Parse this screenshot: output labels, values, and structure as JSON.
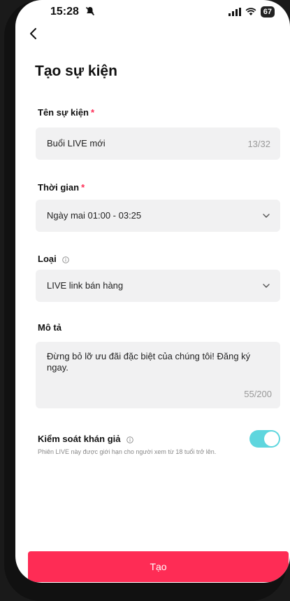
{
  "status_bar": {
    "time": "15:28",
    "battery": "67"
  },
  "header": {
    "title": "Tạo sự kiện"
  },
  "event_name": {
    "label": "Tên sự kiện",
    "required_mark": "*",
    "value": "Buổi LIVE mới",
    "counter": "13/32"
  },
  "time": {
    "label": "Thời gian",
    "required_mark": "*",
    "value": "Ngày mai 01:00 - 03:25"
  },
  "type": {
    "label": "Loại",
    "value": "LIVE link bán hàng"
  },
  "description": {
    "label": "Mô tả",
    "value": "Đừng bỏ lỡ ưu đãi đặc biệt của chúng tôi! Đăng ký ngay.",
    "counter": "55/200"
  },
  "audience_control": {
    "label": "Kiểm soát khán giả",
    "subtitle": "Phiên LIVE này được giới hạn cho người xem từ 18 tuổi trở lên.",
    "enabled": true
  },
  "footer": {
    "create_label": "Tạo"
  },
  "colors": {
    "accent": "#fe2c55",
    "toggle_on": "#5ed6de"
  }
}
